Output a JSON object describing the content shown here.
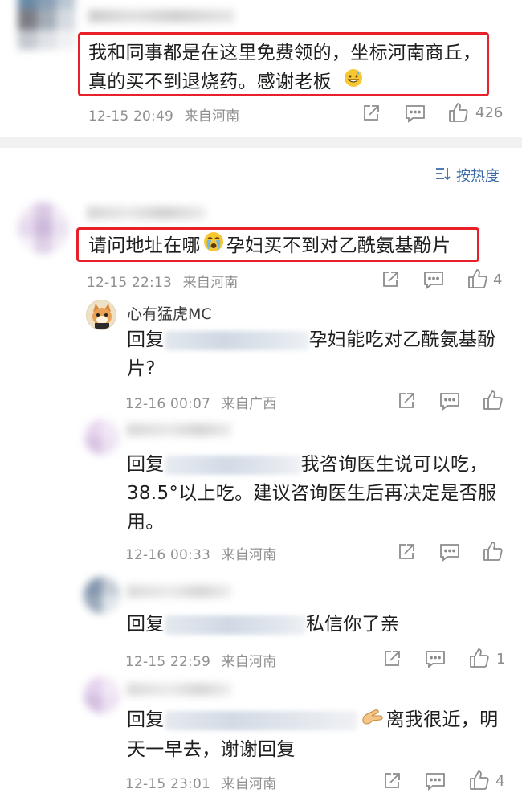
{
  "comments": [
    {
      "text_line1": "我和同事都是在这里免费领的，坐标河南商丘，",
      "text_line2": "真的买不到退烧药。感谢老板",
      "time": "12-15 20:49",
      "location": "来自河南",
      "likes": "426"
    },
    {
      "text_before": "请问地址在哪",
      "text_after": "孕妇买不到对乙酰氨基酚片",
      "time": "12-15 22:13",
      "location": "来自河南",
      "likes": "4"
    }
  ],
  "sort_label": "按热度",
  "replies": [
    {
      "username": "心有猛虎MC",
      "reply_prefix": "回复",
      "text_line1": "孕妇能吃对乙酰氨基酚",
      "text_line2": "片?",
      "time": "12-16 00:07",
      "location": "来自广西",
      "likes": ""
    },
    {
      "reply_prefix": "回复",
      "text_line1": "我咨询医生说可以吃，",
      "text_line2": "38.5°以上吃。建议咨询医生后再决定是否服",
      "text_line3": "用。",
      "time": "12-16 00:33",
      "location": "来自河南",
      "likes": ""
    },
    {
      "reply_prefix": "回复",
      "text_line1": "私信你了亲",
      "time": "12-15 22:59",
      "location": "来自河南",
      "likes": "1"
    },
    {
      "reply_prefix": "回复",
      "text_line1": "离我很近，明",
      "text_line2": "天一早去，谢谢回复",
      "time": "12-15 23:01",
      "location": "来自河南",
      "likes": "4"
    }
  ],
  "colors": {
    "highlight_border": "#e8202a",
    "link_blue": "#3c6aa8",
    "meta_gray": "#8f8f8f"
  }
}
